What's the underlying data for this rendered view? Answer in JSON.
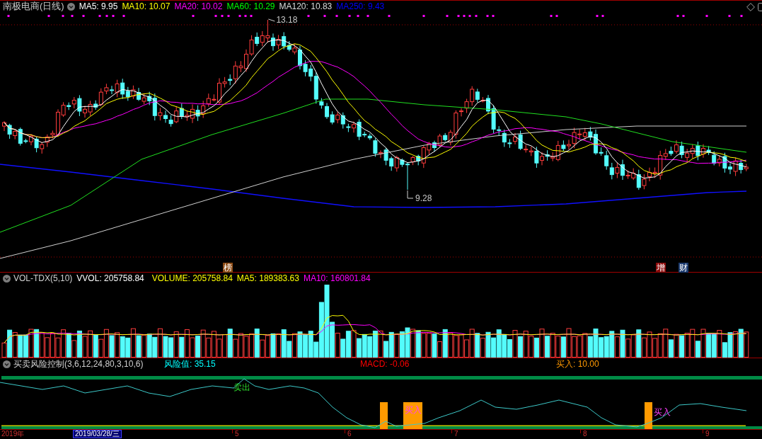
{
  "chart_header": {
    "title": "南极电商(日线)",
    "legend": [
      {
        "label": "MA5: 9.95",
        "color": "#ffffff"
      },
      {
        "label": "MA10: 10.07",
        "color": "#ffff00"
      },
      {
        "label": "MA20: 10.02",
        "color": "#ff00ff"
      },
      {
        "label": "MA60: 10.29",
        "color": "#00ff00"
      },
      {
        "label": "MA120: 10.83",
        "color": "#dcdcdc"
      },
      {
        "label": "MA250: 9.43",
        "color": "#0000ff"
      }
    ]
  },
  "price_chart": {
    "high_label": "13.18",
    "low_label": "9.28",
    "event_tags": [
      {
        "label": "榜",
        "color": "#8b4a14"
      },
      {
        "label": "增",
        "color": "#8b0a0a"
      },
      {
        "label": "财",
        "color": "#1c3a6e"
      }
    ]
  },
  "volume_panel": {
    "title": "VOL-TDX(5,10)",
    "legend": [
      {
        "label": "VVOL: 205758.84",
        "color": "#ffffff"
      },
      {
        "label": "VOLUME: 205758.84",
        "color": "#ffff00"
      },
      {
        "label": "MA5: 189383.63",
        "color": "#ffff00"
      },
      {
        "label": "MA10: 160801.84",
        "color": "#ff00ff"
      }
    ]
  },
  "indicator_panel": {
    "title": "买卖风险控制(3,6,12,24,80,3,10,6)",
    "legend": [
      {
        "label": "风险值: 35.15",
        "color": "#00ffff"
      },
      {
        "label": "MACD: -0.06",
        "color": "#ff0000"
      },
      {
        "label": "买入: 10.00",
        "color": "#ff9900"
      }
    ],
    "signals": [
      {
        "label": "卖出",
        "kind": "sell"
      },
      {
        "label": "买入",
        "kind": "buy"
      },
      {
        "label": "买入",
        "kind": "buy"
      }
    ]
  },
  "time_axis": [
    {
      "label": "2019年",
      "kind": "year"
    },
    {
      "label": "2019/03/28/三",
      "kind": "cursor"
    },
    {
      "label": "5",
      "kind": "month"
    },
    {
      "label": "6",
      "kind": "month"
    },
    {
      "label": "7",
      "kind": "month"
    },
    {
      "label": "8",
      "kind": "month"
    },
    {
      "label": "9",
      "kind": "month"
    }
  ]
}
